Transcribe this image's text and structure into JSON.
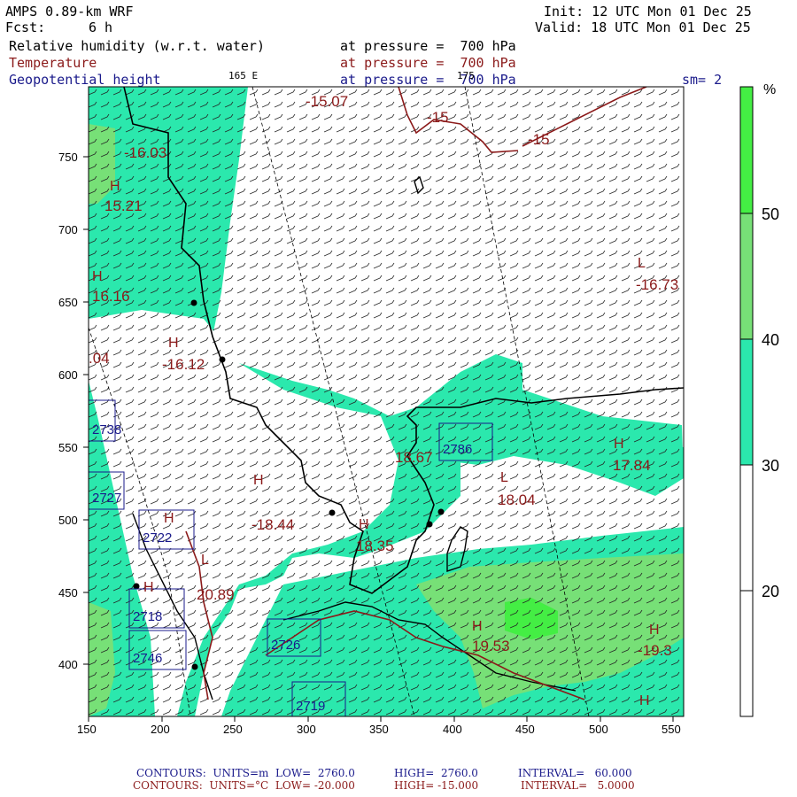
{
  "header": {
    "model": "AMPS 0.89-km WRF",
    "init": "Init: 12 UTC Mon 01 Dec 25",
    "fcst_label": "Fcst:",
    "fcst_value": "6 h",
    "valid": "Valid: 18 UTC Mon 01 Dec 25",
    "fields": [
      {
        "name": "Relative humidity (w.r.t. water)",
        "level": "at pressure =  700 hPa",
        "color": "#000000"
      },
      {
        "name": "Temperature",
        "level": "at pressure =  700 hPa",
        "color": "#8b1a1a"
      },
      {
        "name": "Geopotential height",
        "level": "at pressure =  700 hPa",
        "color": "#1a1a8b"
      }
    ],
    "smoothing": "sm= 2",
    "meridian_labels": [
      "165 E",
      "175"
    ]
  },
  "colorbar": {
    "unit": "%",
    "labels": [
      "50",
      "40",
      "30",
      "20"
    ],
    "colors": [
      "#44ee44",
      "#77e077",
      "#2be8ad",
      "#ffffff"
    ]
  },
  "axes": {
    "x_ticks": [
      "150",
      "200",
      "250",
      "300",
      "350",
      "400",
      "450",
      "500",
      "550"
    ],
    "y_ticks": [
      "750",
      "700",
      "650",
      "600",
      "550",
      "500",
      "450",
      "400"
    ]
  },
  "temperature_labels": [
    {
      "text": "-15.07"
    },
    {
      "text": "-15"
    },
    {
      "text": "-15"
    },
    {
      "text": "-16.03"
    },
    {
      "text": "15.21"
    },
    {
      "text": "-16.73"
    },
    {
      "text": "16.16"
    },
    {
      "text": "-16.12"
    },
    {
      "text": ".04"
    },
    {
      "text": "18.67"
    },
    {
      "text": "17.84"
    },
    {
      "text": "18.04"
    },
    {
      "text": "-18.44"
    },
    {
      "text": "18.35"
    },
    {
      "text": "20.89"
    },
    {
      "text": "19.53"
    },
    {
      "text": "-19.3"
    }
  ],
  "pressure_markers": [
    {
      "text": "H"
    },
    {
      "text": "H"
    },
    {
      "text": "L"
    },
    {
      "text": "H"
    },
    {
      "text": "H"
    },
    {
      "text": "L"
    },
    {
      "text": "H"
    },
    {
      "text": "H"
    },
    {
      "text": "H"
    },
    {
      "text": "H"
    },
    {
      "text": "L"
    },
    {
      "text": "H"
    },
    {
      "text": "H"
    },
    {
      "text": "H"
    }
  ],
  "height_boxes": [
    {
      "text": "2786"
    },
    {
      "text": "2722"
    },
    {
      "text": "2718"
    },
    {
      "text": "2746"
    },
    {
      "text": "2726"
    },
    {
      "text": "2719"
    },
    {
      "text": "2727"
    },
    {
      "text": "2738"
    }
  ],
  "footer": {
    "line1": {
      "label": "CONTOURS:  UNITS=m  LOW=  2760.0",
      "high": "HIGH=  2760.0",
      "interval": "INTERVAL=   60.000",
      "color": "#1a1a8b"
    },
    "line2": {
      "label": "CONTOURS:  UNITS=°C  LOW= -20.000",
      "high": "HIGH= -15.000",
      "interval": "INTERVAL=   5.0000",
      "color": "#8b1a1a"
    }
  }
}
